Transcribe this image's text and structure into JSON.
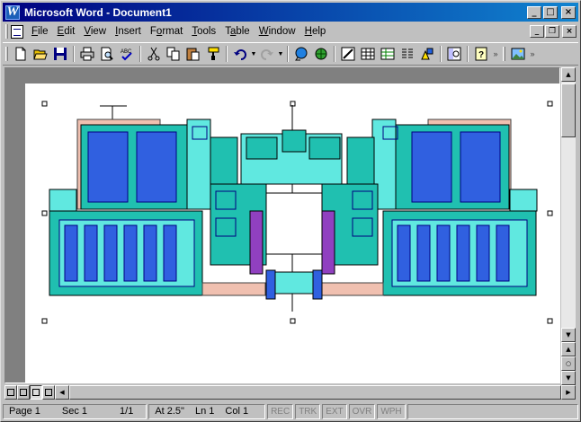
{
  "window": {
    "title": "Microsoft Word - Document1",
    "app_icon_letter": "W"
  },
  "caption_buttons": {
    "minimize": "_",
    "maximize": "□",
    "close": "×"
  },
  "menu": {
    "items": [
      "File",
      "Edit",
      "View",
      "Insert",
      "Format",
      "Tools",
      "Table",
      "Window",
      "Help"
    ],
    "mnemonics": [
      "F",
      "E",
      "V",
      "I",
      "o",
      "T",
      "a",
      "W",
      "H"
    ]
  },
  "mdi_buttons": {
    "minimize": "_",
    "restore": "❐",
    "close": "×"
  },
  "toolbar": {
    "icons": [
      "new-icon",
      "open-icon",
      "save-icon",
      "print-icon",
      "print-preview-icon",
      "spelling-icon",
      "cut-icon",
      "copy-icon",
      "paste-icon",
      "format-painter-icon",
      "undo-icon",
      "redo-icon",
      "hyperlink-icon",
      "web-toolbar-icon",
      "tables-borders-icon",
      "insert-table-icon",
      "insert-excel-icon",
      "columns-icon",
      "drawing-icon",
      "document-map-icon",
      "help-icon",
      "picture-icon"
    ],
    "overflow": "»"
  },
  "status": {
    "page": "Page 1",
    "sec": "Sec 1",
    "pages": "1/1",
    "at": "At 2.5\"",
    "ln": "Ln 1",
    "col": "Col 1",
    "modes": [
      "REC",
      "TRK",
      "EXT",
      "OVR",
      "WPH"
    ]
  },
  "colors": {
    "titlebar_start": "#000080",
    "titlebar_end": "#1084d0",
    "chip_teal": "#20c0b0",
    "chip_blue": "#3060e0",
    "chip_cyan": "#60e8e0",
    "chip_purple": "#9040c0",
    "chip_pink": "#f0c0b0"
  }
}
